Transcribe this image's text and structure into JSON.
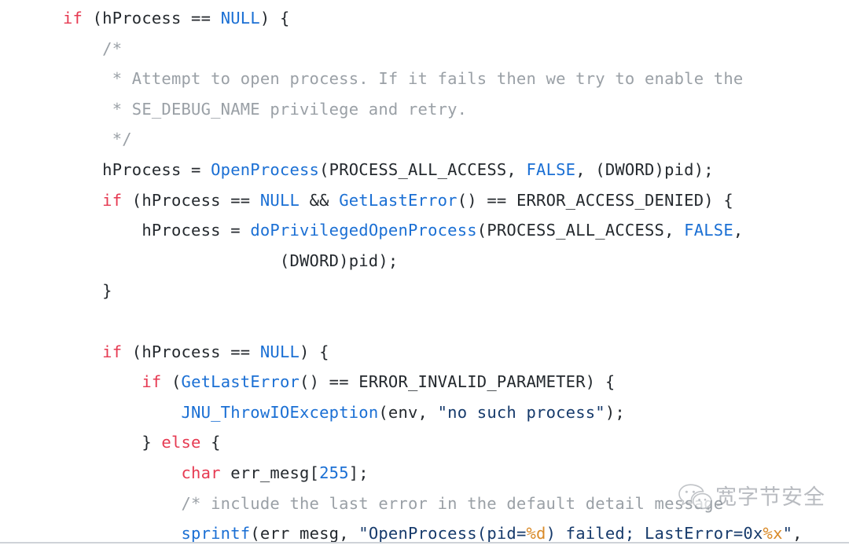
{
  "document": {
    "kind": "source-code-snippet",
    "language": "C",
    "background_color": "#ffffff",
    "colors": {
      "keyword": "#e63a52",
      "function": "#1a6fd4",
      "constant": "#1a6fd4",
      "number": "#1a6fd4",
      "string": "#163a6b",
      "format_specifier": "#d98a28",
      "comment": "#9aa0a6",
      "plain": "#24292e"
    }
  },
  "code": {
    "lines": [
      {
        "id": "line-1",
        "tokens": [
          {
            "t": "kw",
            "s": "if"
          },
          {
            "t": "plain",
            "s": " (hProcess == "
          },
          {
            "t": "const",
            "s": "NULL"
          },
          {
            "t": "plain",
            "s": ") {"
          }
        ]
      },
      {
        "id": "line-2",
        "tokens": [
          {
            "t": "cmt",
            "s": "    /*"
          }
        ]
      },
      {
        "id": "line-3",
        "tokens": [
          {
            "t": "cmt",
            "s": "     * Attempt to open process. If it fails then we try to enable the"
          }
        ]
      },
      {
        "id": "line-4",
        "tokens": [
          {
            "t": "cmt",
            "s": "     * SE_DEBUG_NAME privilege and retry."
          }
        ]
      },
      {
        "id": "line-5",
        "tokens": [
          {
            "t": "cmt",
            "s": "     */"
          }
        ]
      },
      {
        "id": "line-6",
        "tokens": [
          {
            "t": "plain",
            "s": "    hProcess = "
          },
          {
            "t": "fn",
            "s": "OpenProcess"
          },
          {
            "t": "plain",
            "s": "(PROCESS_ALL_ACCESS, "
          },
          {
            "t": "const",
            "s": "FALSE"
          },
          {
            "t": "plain",
            "s": ", (DWORD)pid);"
          }
        ]
      },
      {
        "id": "line-7",
        "tokens": [
          {
            "t": "plain",
            "s": "    "
          },
          {
            "t": "kw",
            "s": "if"
          },
          {
            "t": "plain",
            "s": " (hProcess == "
          },
          {
            "t": "const",
            "s": "NULL"
          },
          {
            "t": "plain",
            "s": " && "
          },
          {
            "t": "fn",
            "s": "GetLastError"
          },
          {
            "t": "plain",
            "s": "() == ERROR_ACCESS_DENIED) {"
          }
        ]
      },
      {
        "id": "line-8",
        "tokens": [
          {
            "t": "plain",
            "s": "        hProcess = "
          },
          {
            "t": "fn",
            "s": "doPrivilegedOpenProcess"
          },
          {
            "t": "plain",
            "s": "(PROCESS_ALL_ACCESS, "
          },
          {
            "t": "const",
            "s": "FALSE"
          },
          {
            "t": "plain",
            "s": ","
          }
        ]
      },
      {
        "id": "line-9",
        "tokens": [
          {
            "t": "plain",
            "s": "                      (DWORD)pid);"
          }
        ]
      },
      {
        "id": "line-10",
        "tokens": [
          {
            "t": "plain",
            "s": "    }"
          }
        ]
      },
      {
        "id": "line-11",
        "tokens": [
          {
            "t": "plain",
            "s": ""
          }
        ]
      },
      {
        "id": "line-12",
        "tokens": [
          {
            "t": "plain",
            "s": "    "
          },
          {
            "t": "kw",
            "s": "if"
          },
          {
            "t": "plain",
            "s": " (hProcess == "
          },
          {
            "t": "const",
            "s": "NULL"
          },
          {
            "t": "plain",
            "s": ") {"
          }
        ]
      },
      {
        "id": "line-13",
        "tokens": [
          {
            "t": "plain",
            "s": "        "
          },
          {
            "t": "kw",
            "s": "if"
          },
          {
            "t": "plain",
            "s": " ("
          },
          {
            "t": "fn",
            "s": "GetLastError"
          },
          {
            "t": "plain",
            "s": "() == ERROR_INVALID_PARAMETER) {"
          }
        ]
      },
      {
        "id": "line-14",
        "tokens": [
          {
            "t": "plain",
            "s": "            "
          },
          {
            "t": "fn",
            "s": "JNU_ThrowIOException"
          },
          {
            "t": "plain",
            "s": "(env, "
          },
          {
            "t": "str",
            "s": "\"no such process\""
          },
          {
            "t": "plain",
            "s": ");"
          }
        ]
      },
      {
        "id": "line-15",
        "tokens": [
          {
            "t": "plain",
            "s": "        } "
          },
          {
            "t": "kw",
            "s": "else"
          },
          {
            "t": "plain",
            "s": " {"
          }
        ]
      },
      {
        "id": "line-16",
        "tokens": [
          {
            "t": "plain",
            "s": "            "
          },
          {
            "t": "kw",
            "s": "char"
          },
          {
            "t": "plain",
            "s": " err_mesg["
          },
          {
            "t": "num",
            "s": "255"
          },
          {
            "t": "plain",
            "s": "];"
          }
        ]
      },
      {
        "id": "line-17",
        "tokens": [
          {
            "t": "cmt",
            "s": "            /* include the last error in the default detail message"
          }
        ]
      },
      {
        "id": "line-18",
        "tokens": [
          {
            "t": "plain",
            "s": "            "
          },
          {
            "t": "fn",
            "s": "sprintf"
          },
          {
            "t": "plain",
            "s": "(err mesg, "
          },
          {
            "t": "str",
            "s": "\"OpenProcess(pid="
          },
          {
            "t": "fmt",
            "s": "%d"
          },
          {
            "t": "str",
            "s": ") failed; LastError=0x"
          },
          {
            "t": "fmt",
            "s": "%x"
          },
          {
            "t": "str",
            "s": "\""
          },
          {
            "t": "plain",
            "s": ","
          }
        ]
      }
    ]
  },
  "watermark": {
    "logo_icon": "wechat-logo-icon",
    "text": "宽字节安全"
  }
}
